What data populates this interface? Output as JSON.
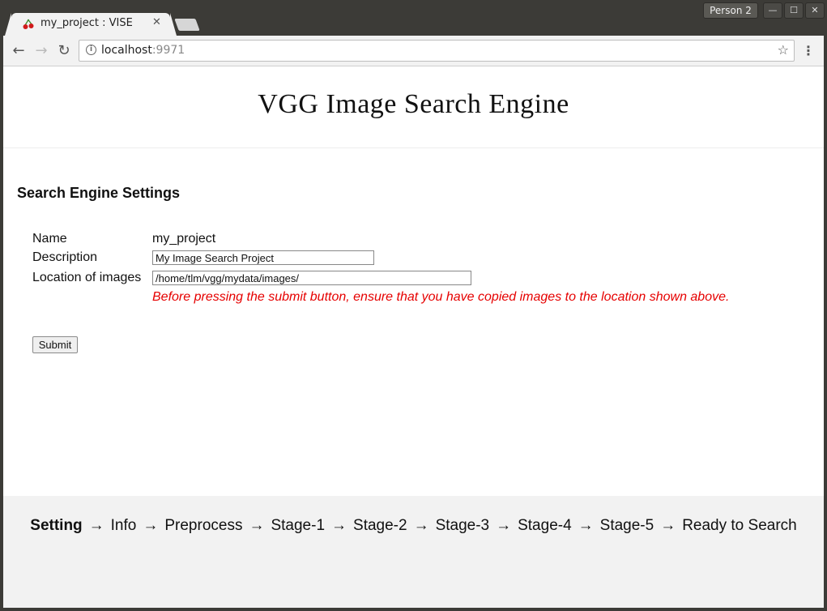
{
  "browser": {
    "tab_title": "my_project : VISE",
    "tab_close": "✕",
    "profile_label": "Person 2",
    "window_controls": [
      "—",
      "☐",
      "✕"
    ],
    "url_host": "localhost",
    "url_port": ":9971"
  },
  "icons": {
    "favicon": "cherry-icon",
    "back": "back-arrow-icon",
    "forward": "forward-arrow-icon",
    "reload": "reload-icon",
    "info": "info-icon",
    "star": "star-icon",
    "menu": "menu-dots-icon"
  },
  "page": {
    "title": "VGG Image Search Engine",
    "section_title": "Search Engine Settings",
    "form": {
      "name_label": "Name",
      "name_value": "my_project",
      "description_label": "Description",
      "description_value": "My Image Search Project",
      "location_label": "Location of images",
      "location_value": "/home/tlm/vgg/mydata/images/",
      "warning": "Before pressing the submit button, ensure that you have copied images to the location shown above.",
      "submit_label": "Submit"
    },
    "steps": [
      "Setting",
      "Info",
      "Preprocess",
      "Stage-1",
      "Stage-2",
      "Stage-3",
      "Stage-4",
      "Stage-5",
      "Ready to Search"
    ],
    "arrow": "→"
  },
  "colors": {
    "warning": "#e60000",
    "footer_bg": "#f2f2f2"
  }
}
